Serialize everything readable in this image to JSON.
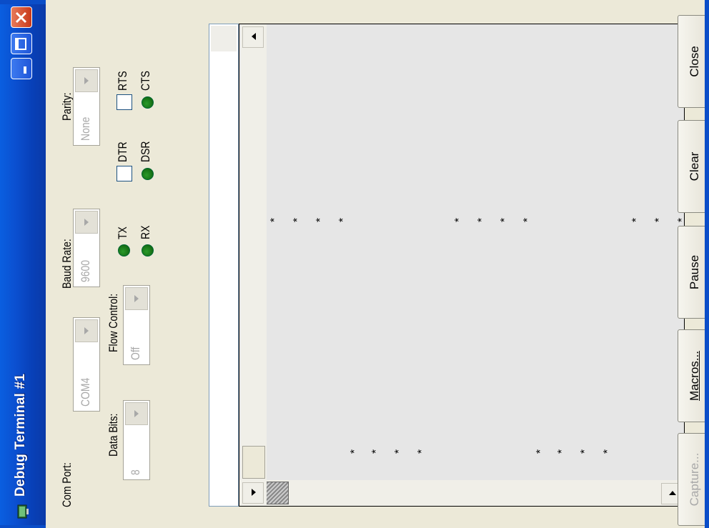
{
  "window": {
    "title": "Debug Terminal #1",
    "controls": [
      "minimize",
      "maximize",
      "close"
    ]
  },
  "settings": {
    "com_port": {
      "label": "Com Port:",
      "value": "COM4"
    },
    "baud_rate": {
      "label": "Baud Rate:",
      "value": "9600"
    },
    "parity": {
      "label": "Parity:",
      "value": "None"
    },
    "data_bits": {
      "label": "Data Bits:",
      "value": "8"
    },
    "flow_control": {
      "label": "Flow Control:",
      "value": "Off"
    }
  },
  "lines": {
    "tx": "TX",
    "rx": "RX",
    "dtr": "DTR",
    "dsr": "DSR",
    "rts": "RTS",
    "cts": "CTS",
    "led_color": "#118811"
  },
  "terminal": {
    "char": "*",
    "background": "#e6e6e6"
  },
  "buttons": {
    "capture": "Capture...",
    "macros": "Macros...",
    "pause": "Pause",
    "clear": "Clear",
    "close": "Close"
  }
}
